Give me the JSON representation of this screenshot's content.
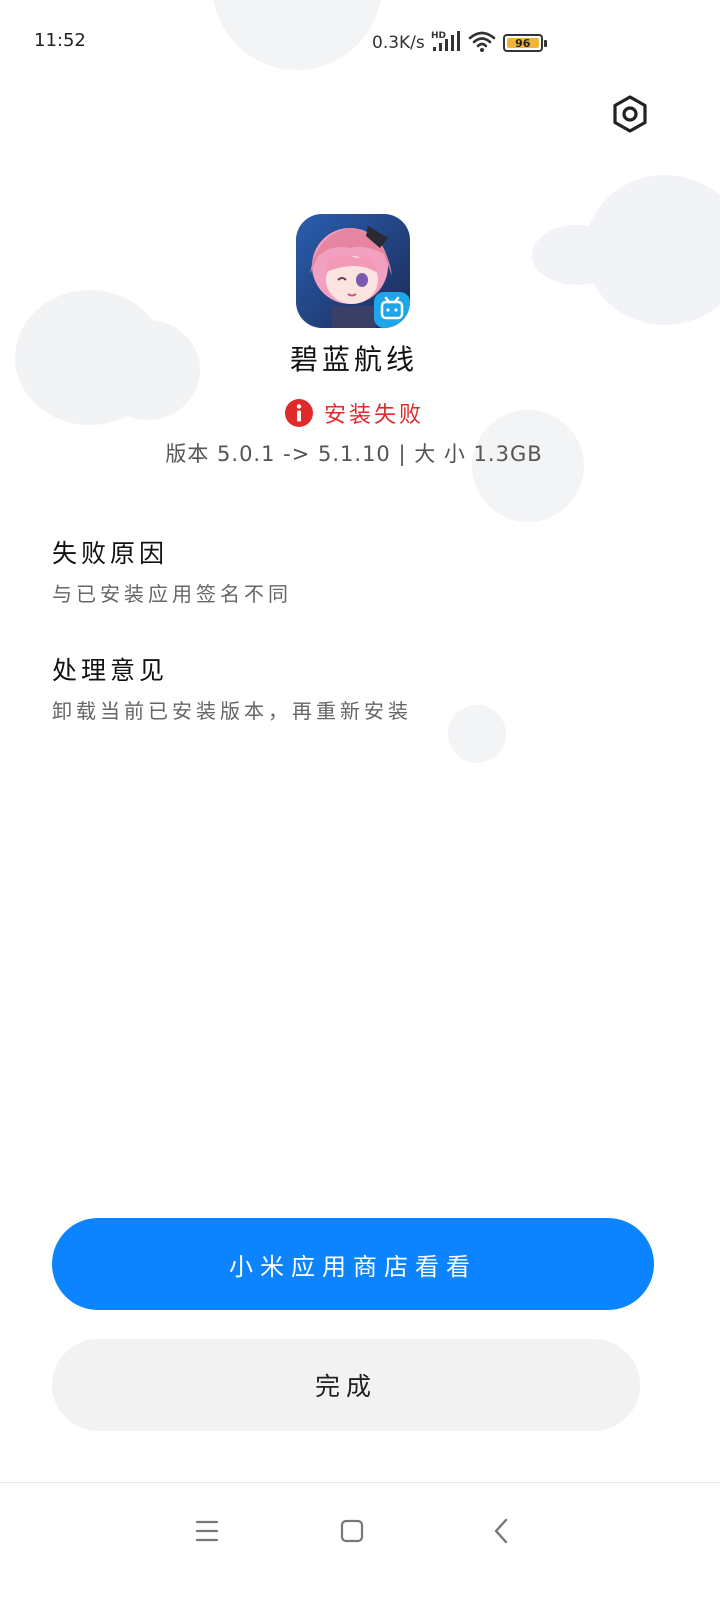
{
  "status_bar": {
    "time": "11:52",
    "net_speed": "0.3K/s",
    "signal_badge": "HD",
    "battery_level": "96",
    "battery_color": "#f0b43a"
  },
  "icons": {
    "settings": "settings-hexagon-icon",
    "error": "error-info-icon",
    "nav_menu": "menu-icon",
    "nav_home": "home-square-icon",
    "nav_back": "back-chevron-icon"
  },
  "app": {
    "name": "碧蓝航线",
    "install_status": "安装失败",
    "version_info": "版本 5.0.1 -> 5.1.10 | 大 小 1.3GB",
    "status_color": "#e02a2a"
  },
  "failure_reason": {
    "title": "失败原因",
    "text": "与已安装应用签名不同"
  },
  "suggestion": {
    "title": "处理意见",
    "text": "卸载当前已安装版本，再重新安装"
  },
  "buttons": {
    "store_label": "小米应用商店看看",
    "done_label": "完成",
    "primary_color": "#0d84ff"
  }
}
